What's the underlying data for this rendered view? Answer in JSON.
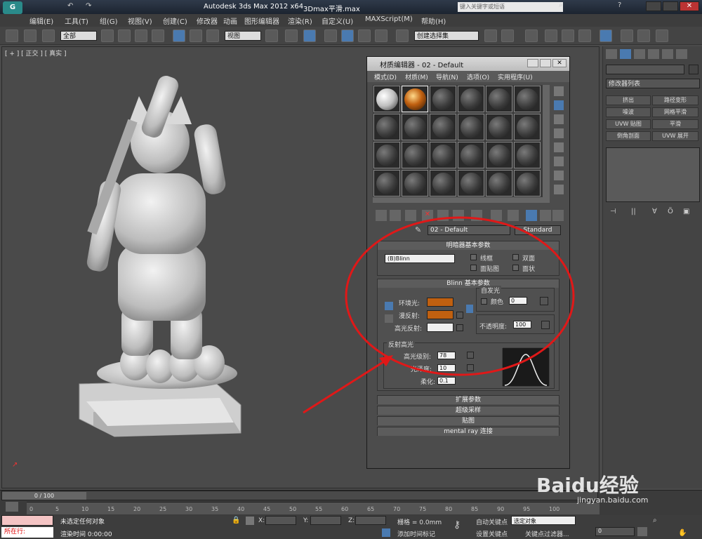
{
  "title_bar": {
    "app_title": "Autodesk 3ds Max  2012 x64",
    "file_name": "3Dmax平滑.max",
    "search_placeholder": "键入关键字或短语"
  },
  "menu": [
    "编辑(E)",
    "工具(T)",
    "组(G)",
    "视图(V)",
    "创建(C)",
    "修改器",
    "动画",
    "图形编辑器",
    "渲染(R)",
    "自定义(U)",
    "MAXScript(M)",
    "帮助(H)"
  ],
  "toolbar": {
    "selection_filter": "全部",
    "view_dropdown": "视图",
    "selection_set": "创建选择集"
  },
  "viewport": {
    "label": "[ + ] [ 正交 ] [ 真实 ]"
  },
  "command_panel": {
    "modifier_list": "修改器列表",
    "buttons": [
      "挤出",
      "路径变形",
      "噪波",
      "网格平滑",
      "UVW 贴图",
      "平滑",
      "倒角剖面",
      "UVW 展开"
    ]
  },
  "material_editor": {
    "title": "材质编辑器 - 02 - Default",
    "menu": [
      "模式(D)",
      "材质(M)",
      "导航(N)",
      "选项(O)",
      "实用程序(U)"
    ],
    "material_name": "02 - Default",
    "material_type": "Standard",
    "shader_rollout": {
      "title": "明暗器基本参数",
      "shader": "(B)Blinn",
      "wire": "线框",
      "two_sided": "双面",
      "face_map": "面贴图",
      "faceted": "面状"
    },
    "blinn_rollout": {
      "title": "Blinn 基本参数",
      "self_illum_title": "自发光",
      "color_label": "颜色",
      "color_value": "0",
      "ambient": "环境光:",
      "diffuse": "漫反射:",
      "specular": "高光反射:",
      "opacity_label": "不透明度:",
      "opacity_value": "100",
      "ambient_color": "#c06010",
      "diffuse_color": "#c06010",
      "specular_color": "#eeeeee"
    },
    "specular_rollout": {
      "title": "反射高光",
      "spec_level_label": "高光级别:",
      "spec_level": "78",
      "gloss_label": "光泽度:",
      "gloss": "10",
      "soften_label": "柔化:",
      "soften": "0.1"
    },
    "collapsed_rollouts": [
      "扩展参数",
      "超级采样",
      "贴图",
      "mental ray 连接"
    ]
  },
  "timeline": {
    "frame_counter": "0 / 100",
    "ticks": [
      "0",
      "5",
      "10",
      "15",
      "20",
      "25",
      "30",
      "35",
      "40",
      "45",
      "50",
      "55",
      "60",
      "65",
      "70",
      "75",
      "80",
      "85",
      "90",
      "95",
      "100"
    ]
  },
  "status": {
    "left_label": "所在行:",
    "selection_status": "未选定任何对象",
    "render_time": "渲染时间  0:00:00",
    "x_label": "X:",
    "y_label": "Y:",
    "z_label": "Z:",
    "grid": "栅格 = 0.0mm",
    "auto_key": "自动关键点",
    "selected": "选定对象",
    "set_key": "设置关键点",
    "key_filters": "关键点过滤器...",
    "add_time_tag": "添加时间标记",
    "frame_value": "0"
  },
  "watermark": {
    "brand": "Baidu经验",
    "url": "jingyan.baidu.com"
  },
  "colors": {
    "annotation_red": "#e01818"
  }
}
